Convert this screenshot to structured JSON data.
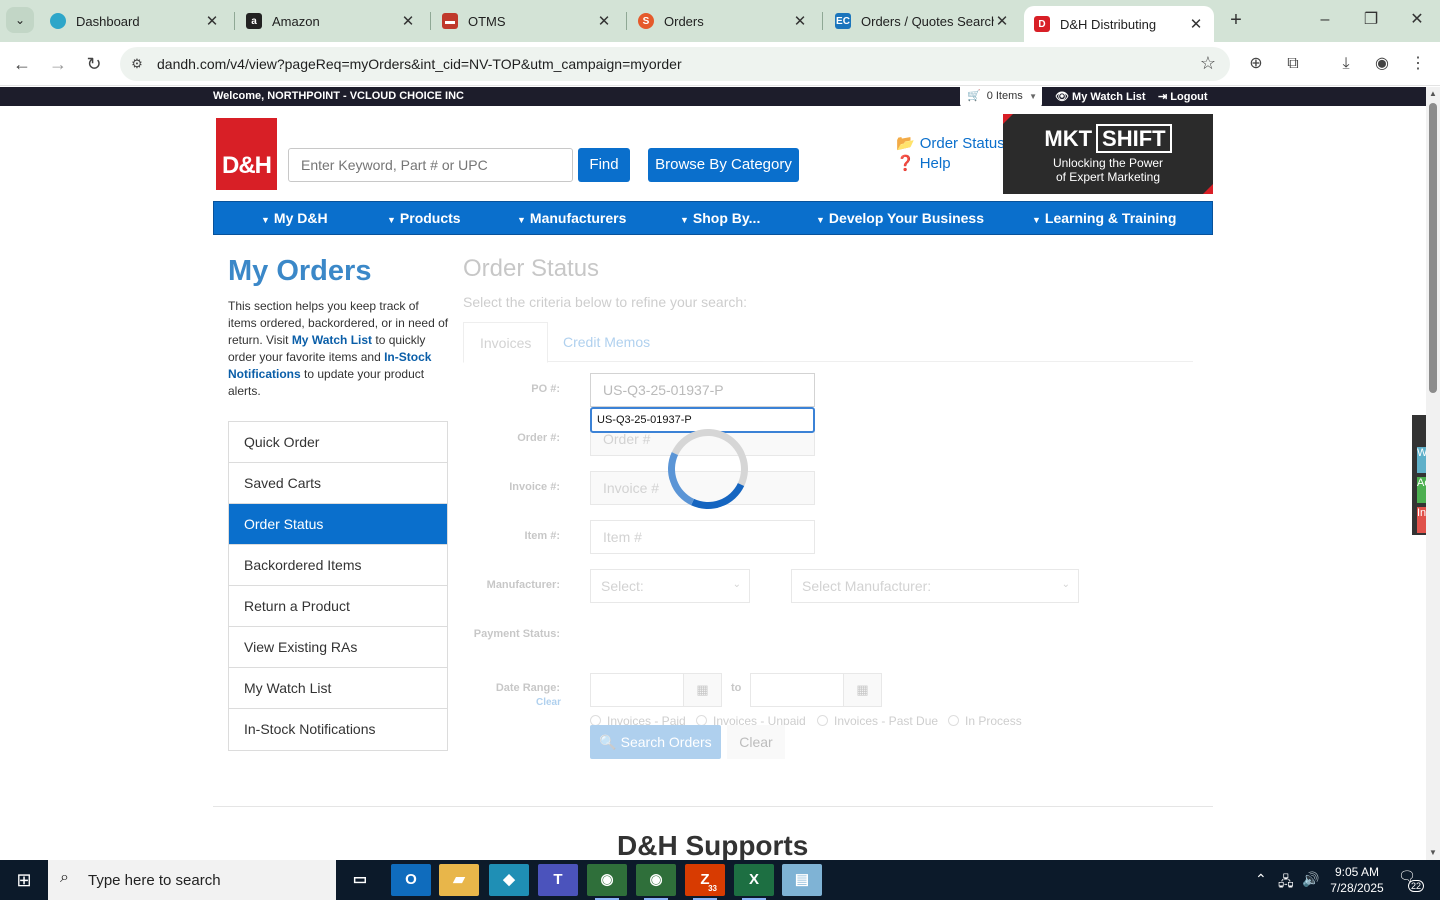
{
  "browser": {
    "tabs": [
      {
        "title": "Dashboard",
        "favicon": "hexagon-icon",
        "color": "#2ea6c9"
      },
      {
        "title": "Amazon",
        "favicon": "amazon-icon",
        "color": "#222222"
      },
      {
        "title": "OTMS",
        "favicon": "truck-icon",
        "color": "#c0392b"
      },
      {
        "title": "Orders",
        "favicon": "swirl-icon",
        "color": "#e55a2b"
      },
      {
        "title": "Orders / Quotes Search",
        "favicon": "ec-icon",
        "color": "#1b75bc"
      },
      {
        "title": "D&H Distributing",
        "favicon": "dh-icon",
        "color": "#d81f26"
      }
    ],
    "url": "dandh.com/v4/view?pageReq=myOrders&int_cid=NV-TOP&utm_campaign=myorder"
  },
  "header": {
    "welcome": "Welcome, NORTHPOINT - VCLOUD CHOICE INC",
    "cart_label": "0 Items",
    "watch_list": "My Watch List",
    "logout": "Logout",
    "logo_text": "D&H",
    "search_placeholder": "Enter Keyword, Part # or UPC",
    "find_label": "Find",
    "browse_label": "Browse By Category",
    "order_status_link": "Order Status",
    "help_link": "Help",
    "banner_title_a": "MKT",
    "banner_title_b": "SHIFT",
    "banner_sub_1": "Unlocking the Power",
    "banner_sub_2": "of Expert Marketing"
  },
  "nav": [
    {
      "label": "My D&H"
    },
    {
      "label": "Products"
    },
    {
      "label": "Manufacturers"
    },
    {
      "label": "Shop By..."
    },
    {
      "label": "Develop Your Business"
    },
    {
      "label": "Learning & Training"
    }
  ],
  "sidebar": {
    "title": "My Orders",
    "intro_1": "This section helps you keep track of items ordered, backordered, or in need of return. Visit ",
    "intro_link_1": "My Watch List",
    "intro_2": " to quickly order your favorite items and ",
    "intro_link_2": "In-Stock Notifications",
    "intro_3": " to update your product alerts.",
    "items": [
      {
        "label": "Quick Order"
      },
      {
        "label": "Saved Carts"
      },
      {
        "label": "Order Status"
      },
      {
        "label": "Backordered Items"
      },
      {
        "label": "Return a Product"
      },
      {
        "label": "View Existing RAs"
      },
      {
        "label": "My Watch List"
      },
      {
        "label": "In-Stock Notifications"
      }
    ],
    "active_index": 2
  },
  "form": {
    "title": "Order Status",
    "subtitle": "Select the criteria below to refine your search:",
    "tabs": [
      "Invoices",
      "Credit Memos"
    ],
    "po_label": "PO #:",
    "po_value": "US-Q3-25-01937-P",
    "order_label": "Order #:",
    "order_placeholder": "Order #",
    "invoice_label": "Invoice #:",
    "invoice_placeholder": "Invoice #",
    "item_label": "Item #:",
    "item_placeholder": "Item #",
    "manufacturer_label": "Manufacturer:",
    "select_1": "Select:",
    "select_2": "Select Manufacturer:",
    "payment_label": "Payment Status:",
    "payment_options": [
      "Invoices - Paid",
      "Invoices - Unpaid",
      "Invoices - Past Due",
      "In Process"
    ],
    "date_label": "Date Range:",
    "date_clear": "Clear",
    "date_to": "to",
    "search_button": "Search Orders",
    "clear_button": "Clear",
    "autocomplete": "US-Q3-25-01937-P"
  },
  "footer": {
    "title": "D&H Supports"
  },
  "side_widget": [
    "W",
    "Ac",
    "In"
  ],
  "taskbar": {
    "search_placeholder": "Type here to search",
    "time": "9:05 AM",
    "date": "7/28/2025",
    "notification_count": "22",
    "zoom_badge": "33"
  }
}
